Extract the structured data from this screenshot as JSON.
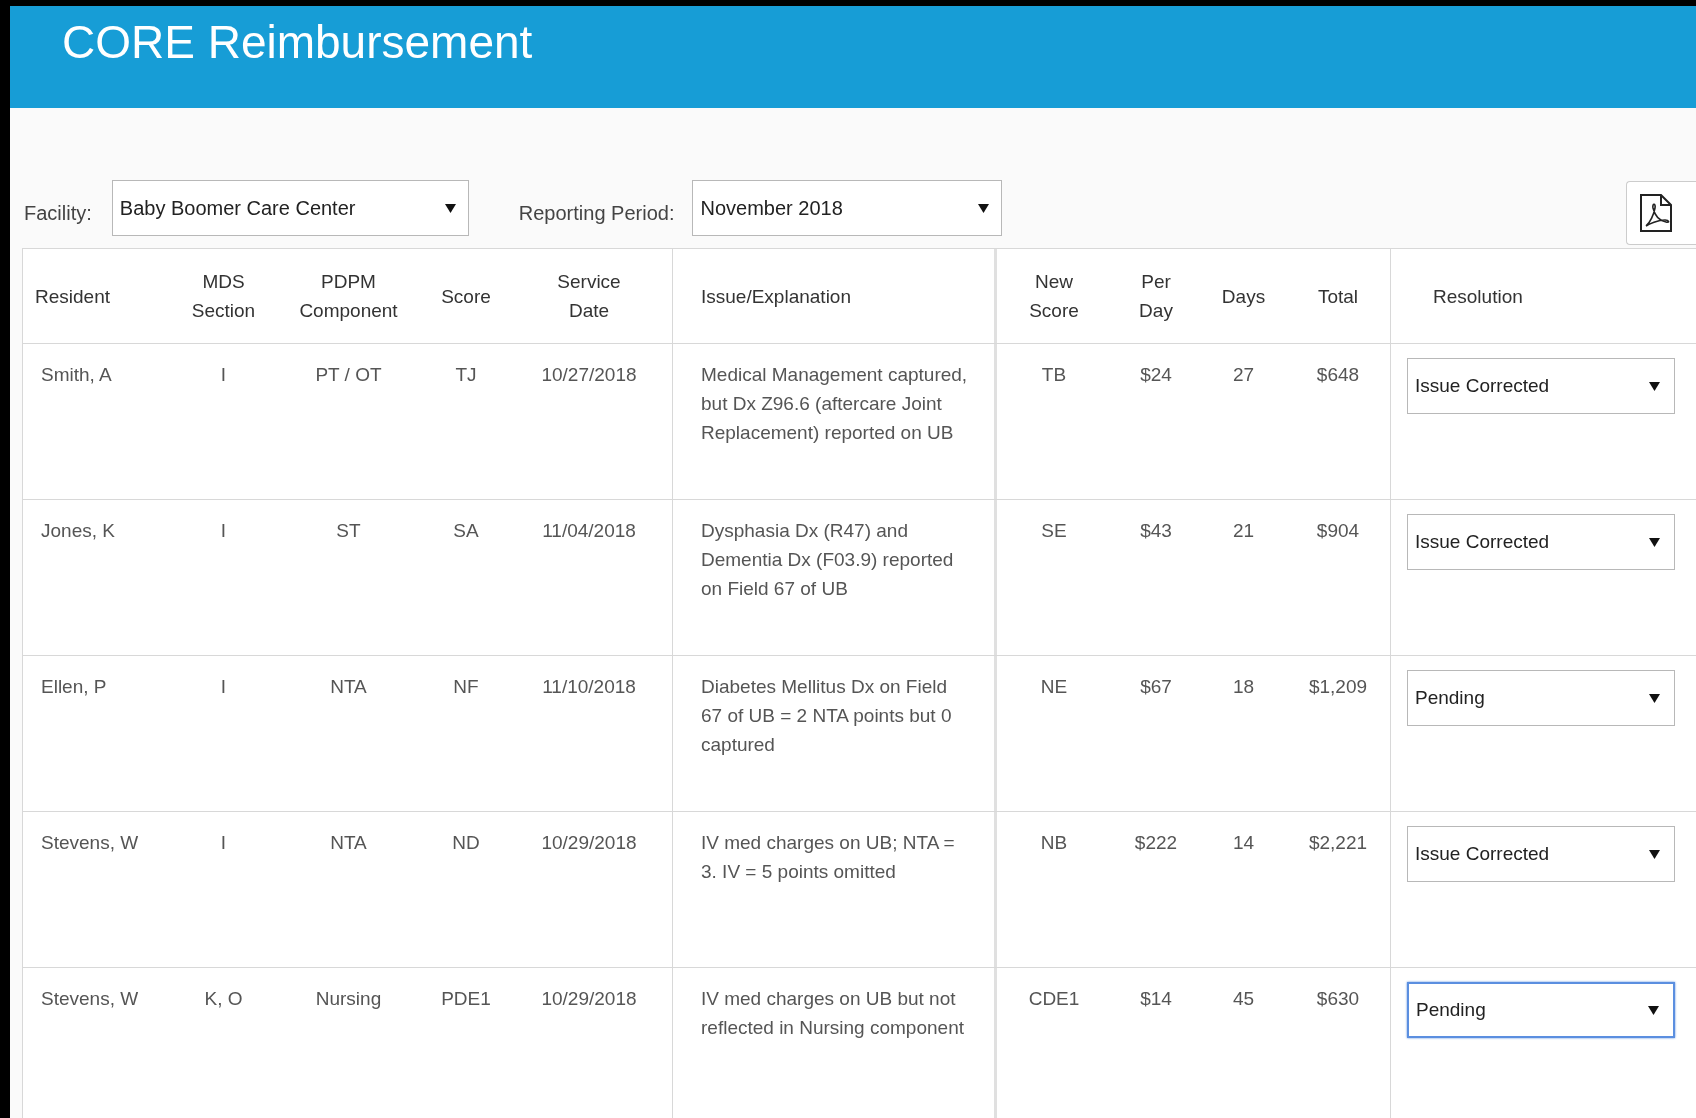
{
  "header": {
    "title": "CORE Reimbursement"
  },
  "filters": [
    {
      "label": "Facility:",
      "value": "Baby Boomer Care Center"
    },
    {
      "label": "Reporting Period:",
      "value": "November 2018"
    }
  ],
  "table": {
    "columns": [
      "Resident",
      "MDS Section",
      "PDPM Component",
      "Score",
      "Service Date",
      "Issue/Explanation",
      "New Score",
      "Per Day",
      "Days",
      "Total",
      "Resolution"
    ],
    "rows": [
      {
        "cells": [
          "Smith, A",
          "I",
          "PT / OT",
          "TJ",
          "10/27/2018",
          "Medical Management captured, but Dx Z96.6 (aftercare Joint Replacement) reported on UB",
          "TB",
          "$24",
          "27",
          "$648"
        ],
        "resolution": {
          "value": "Issue Corrected",
          "focused": false
        }
      },
      {
        "cells": [
          "Jones, K",
          "I",
          "ST",
          "SA",
          "11/04/2018",
          "Dysphasia Dx (R47) and Dementia Dx (F03.9) reported on Field 67 of UB",
          "SE",
          "$43",
          "21",
          "$904"
        ],
        "resolution": {
          "value": "Issue Corrected",
          "focused": false
        }
      },
      {
        "cells": [
          "Ellen, P",
          "I",
          "NTA",
          "NF",
          "11/10/2018",
          "Diabetes Mellitus Dx on Field 67 of UB = 2 NTA points but 0 captured",
          "NE",
          "$67",
          "18",
          "$1,209"
        ],
        "resolution": {
          "value": "Pending",
          "focused": false
        }
      },
      {
        "cells": [
          "Stevens, W",
          "I",
          "NTA",
          "ND",
          "10/29/2018",
          "IV med charges on UB; NTA = 3.  IV = 5 points omitted",
          "NB",
          "$222",
          "14",
          "$2,221"
        ],
        "resolution": {
          "value": "Issue Corrected",
          "focused": false
        }
      },
      {
        "cells": [
          "Stevens, W",
          "K, O",
          "Nursing",
          "PDE1",
          "10/29/2018",
          "IV med charges on UB but not reflected in Nursing component",
          "CDE1",
          "$14",
          "45",
          "$630"
        ],
        "resolution": {
          "value": "Pending",
          "focused": true
        }
      }
    ]
  }
}
